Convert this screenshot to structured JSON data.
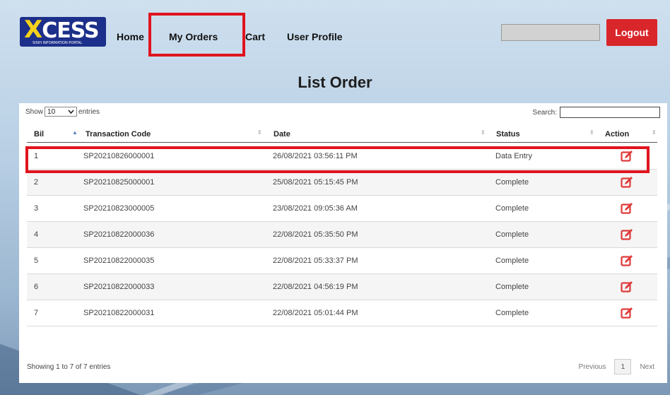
{
  "header": {
    "logo_text": "XCESS",
    "logo_subtext": "SISIH INFORMATION PORTAL",
    "nav": [
      {
        "label": "Home"
      },
      {
        "label": "My Orders"
      },
      {
        "label": "Cart"
      },
      {
        "label": "User Profile"
      }
    ],
    "logout_label": "Logout"
  },
  "page": {
    "title": "List Order"
  },
  "table_controls": {
    "show_label": "Show",
    "page_length": "10",
    "entries_label": "entries",
    "search_label": "Search:"
  },
  "table": {
    "columns": [
      "Bil",
      "Transaction Code",
      "Date",
      "Status",
      "Action"
    ],
    "rows": [
      {
        "bil": "1",
        "code": "SP20210826000001",
        "date": "26/08/2021 03:56:11 PM",
        "status": "Data Entry"
      },
      {
        "bil": "2",
        "code": "SP20210825000001",
        "date": "25/08/2021 05:15:45 PM",
        "status": "Complete"
      },
      {
        "bil": "3",
        "code": "SP20210823000005",
        "date": "23/08/2021 09:05:36 AM",
        "status": "Complete"
      },
      {
        "bil": "4",
        "code": "SP20210822000036",
        "date": "22/08/2021 05:35:50 PM",
        "status": "Complete"
      },
      {
        "bil": "5",
        "code": "SP20210822000035",
        "date": "22/08/2021 05:33:37 PM",
        "status": "Complete"
      },
      {
        "bil": "6",
        "code": "SP20210822000033",
        "date": "22/08/2021 04:56:19 PM",
        "status": "Complete"
      },
      {
        "bil": "7",
        "code": "SP20210822000031",
        "date": "22/08/2021 05:01:44 PM",
        "status": "Complete"
      }
    ],
    "action_icon": "edit-icon"
  },
  "footer": {
    "info": "Showing 1 to 7 of 7 entries",
    "previous_label": "Previous",
    "current_page": "1",
    "next_label": "Next"
  },
  "colors": {
    "accent_red": "#e0141e",
    "logout_bg": "#d9262b",
    "logo_bg": "#1c2f8a",
    "edit_icon": "#e03a3a"
  }
}
